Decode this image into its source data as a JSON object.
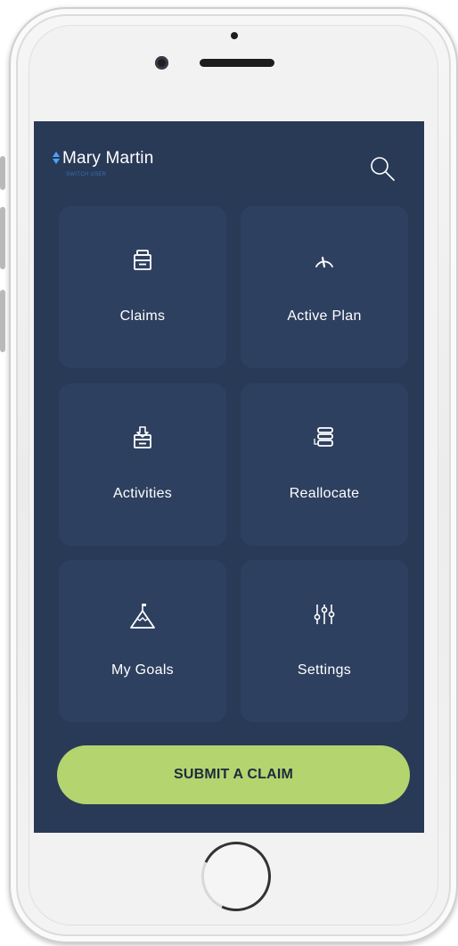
{
  "header": {
    "user_name": "Mary Martin",
    "user_subtitle": "SWITCH USER"
  },
  "tiles": [
    {
      "label": "Claims",
      "icon": "inbox-tray-icon"
    },
    {
      "label": "Active Plan",
      "icon": "gauge-icon"
    },
    {
      "label": "Activities",
      "icon": "download-box-icon"
    },
    {
      "label": "Reallocate",
      "icon": "stack-transfer-icon"
    },
    {
      "label": "My Goals",
      "icon": "mountain-flag-icon"
    },
    {
      "label": "Settings",
      "icon": "sliders-icon"
    }
  ],
  "submit_button": {
    "label": "SUBMIT A CLAIM"
  },
  "colors": {
    "screen_bg": "#293a57",
    "tile_bg": "#2e4060",
    "accent_green": "#b4d46f",
    "subtitle_blue": "#3a6fb0"
  }
}
